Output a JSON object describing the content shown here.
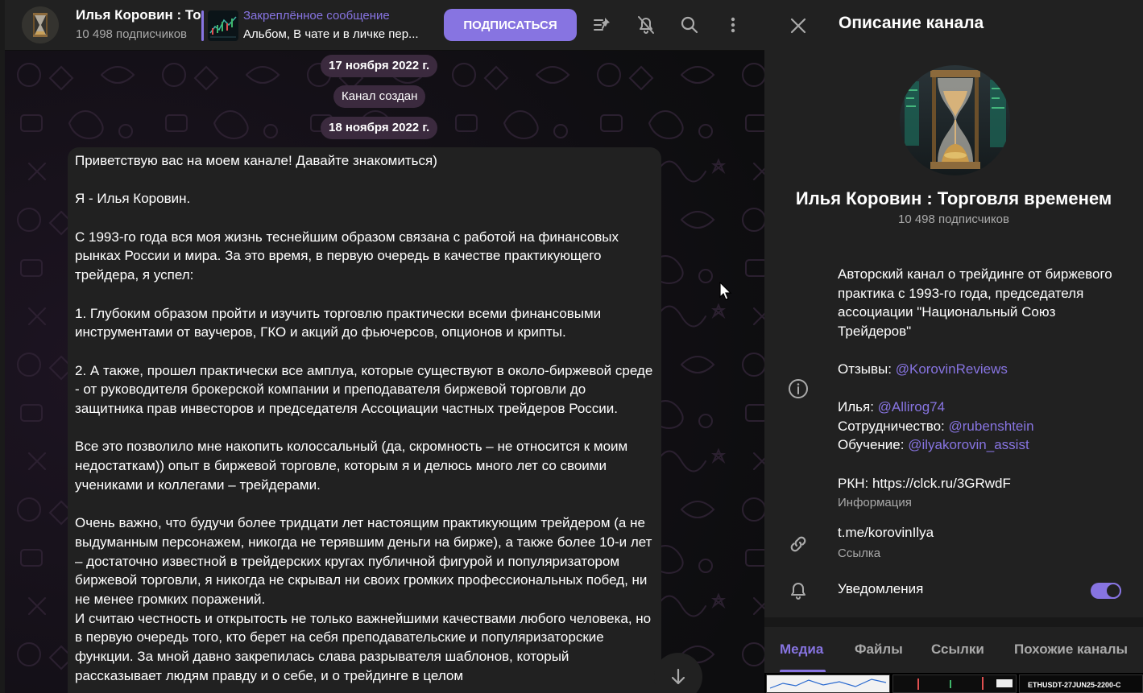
{
  "topbar": {
    "title": "Илья Коровин : Торговля временем",
    "subscribers": "10 498 подписчиков",
    "pinned_title": "Закреплённое сообщение",
    "pinned_text": "Альбом, В чате и в личке пер...",
    "subscribe_label": "ПОДПИСАТЬСЯ"
  },
  "chat": {
    "date1": "17 ноября 2022 г.",
    "service": "Канал создан",
    "date2": "18 ноября 2022 г.",
    "message": {
      "p1": "Приветствую вас на моем канале! Давайте знакомиться)",
      "p2": "Я - Илья Коровин.",
      "p3": "С 1993-го года вся моя жизнь теснейшим образом связана с работой на финансовых рынках России и мира. За это время, в первую очередь в качестве практикующего трейдера, я успел:",
      "p4": "1. Глубоким образом пройти и изучить торговлю практически всеми финансовыми инструментами от ваучеров, ГКО и акций до фьючерсов, опционов и крипты.",
      "p5": "2. А также, прошел практически все амплуа, которые существуют в около-биржевой среде - от руководителя брокерской компании и преподавателя биржевой торговли до защитника прав инвесторов и председателя Ассоциации частных трейдеров России.",
      "p6": "Все это позволило мне накопить колоссальный (да, скромность – не относится к моим недостаткам))  опыт в биржевой торговле, которым я и делюсь много лет со своими учениками и коллегами – трейдерами.",
      "p7": "Очень важно, что будучи более тридцати лет настоящим практикующим трейдером (а не выдуманным персонажем, никогда не терявшим деньги на бирже), а также более 10-и лет – достаточно известной в трейдерских кругах публичной фигурой и популяризатором биржевой торговли, я  никогда не скрывал ни своих громких профессиональных побед,  ни не менее громких поражений.",
      "p8": "И считаю честность и открытость не только важнейшими качествами любого человека, но в первую очередь того, кто берет на себя преподавательские и популяризаторские функции. За мной давно закрепилась слава разрывателя шаблонов, который рассказывает людям правду и о себе, и о трейдинге в целом"
    }
  },
  "panel": {
    "header": "Описание канала",
    "name": "Илья Коровин : Торговля временем",
    "subscribers": "10 498 подписчиков",
    "description": {
      "line1": "Авторский канал о трейдинге от биржевого практика с 1993-го года, председателя ассоциации \"Национальный Союз Трейдеров\"",
      "reviews_label": "Отзывы: ",
      "reviews_mention": "@KorovinReviews",
      "ilya_label": "Илья: ",
      "ilya_mention": "@Allirog74",
      "coop_label": "Сотрудничество: ",
      "coop_mention": "@rubenshtein",
      "edu_label": "Обучение: ",
      "edu_mention": "@ilyakorovin_assist",
      "rkn": "РКН: https://clck.ru/3GRwdF"
    },
    "description_caption": "Информация",
    "link_value": "t.me/korovinIlya",
    "link_caption": "Ссылка",
    "notifications_label": "Уведомления",
    "notifications_on": true,
    "tabs": [
      "Медиа",
      "Файлы",
      "Ссылки",
      "Похожие каналы"
    ],
    "media_caption": "ETHUSDT-27JUN25-2200-C"
  },
  "colors": {
    "accent": "#8774e1",
    "panel_bg": "#212121",
    "chat_bg": "#121212",
    "pill_bg": "#3b2a3e",
    "secondary_text": "#aaaaaa"
  },
  "icons": [
    "pinned-list-icon",
    "mute-bell-icon",
    "search-icon",
    "more-vertical-icon",
    "close-icon",
    "info-icon",
    "link-icon",
    "bell-icon",
    "arrow-down-icon"
  ]
}
